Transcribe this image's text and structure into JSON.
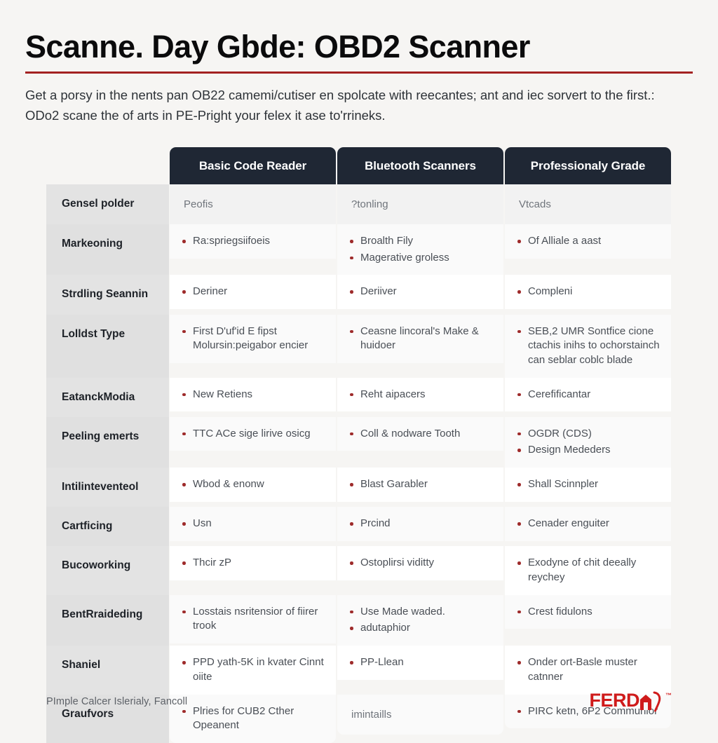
{
  "header": {
    "title": "Scanne. Day Gbde: OBD2 Scanner",
    "intro": "Get a porsy in the nents pan OB22 camemi/cutiser en spolcate with reecantes; ant and iec sorvert to the first.: ODo2 scane the of arts in PE-Pright your felex it ase to'rrineks.",
    "rule_color": "#a32222"
  },
  "table": {
    "corner_label": "",
    "columns": [
      {
        "id": "basic",
        "label": "Basic Code Reader"
      },
      {
        "id": "bluetooth",
        "label": "Bluetooth Scanners"
      },
      {
        "id": "professional",
        "label": "Professionaly Grade"
      }
    ],
    "header_bg": "#1f2734",
    "bullet_color": "#9e2b2b",
    "rows": [
      {
        "label": "Gensel polder",
        "cells": [
          {
            "plain": "Peofis"
          },
          {
            "plain": "?tonling"
          },
          {
            "plain": "Vtcads"
          }
        ]
      },
      {
        "label": "Markeoning",
        "cells": [
          {
            "items": [
              "Ra:spriegsiifoeis"
            ]
          },
          {
            "items": [
              "Broalth Fily",
              "Magerative groless"
            ]
          },
          {
            "items": [
              "Of Alliale a aast"
            ]
          }
        ]
      },
      {
        "label": "Strdling Seannin",
        "cells": [
          {
            "items": [
              "Deriner"
            ]
          },
          {
            "items": [
              "Deriiver"
            ]
          },
          {
            "items": [
              "Compleni"
            ]
          }
        ]
      },
      {
        "label": "Lolldst Type",
        "cells": [
          {
            "items": [
              "First D'uf'id E fipst Molursin:peigabor encier"
            ]
          },
          {
            "items": [
              "Ceasne lincoral's Make & huidoer"
            ]
          },
          {
            "items": [
              "SEB,2 UMR Sontfice cione ctachis inihs to ochorstainch can seblar coblc blade"
            ]
          }
        ]
      },
      {
        "label": "EatanckModia",
        "cells": [
          {
            "items": [
              "New Retiens"
            ]
          },
          {
            "items": [
              "Reht aipacers"
            ]
          },
          {
            "items": [
              "Cerefificantar"
            ]
          }
        ]
      },
      {
        "label": "Peeling emerts",
        "cells": [
          {
            "items": [
              "TTC ACe sige lirive osicg"
            ]
          },
          {
            "items": [
              "Coll & nodware Tooth"
            ]
          },
          {
            "items": [
              "OGDR (CDS)",
              "Design Mededers"
            ]
          }
        ]
      },
      {
        "label": "Intilinteventeol",
        "cells": [
          {
            "items": [
              "Wbod & enonw"
            ]
          },
          {
            "items": [
              "Blast Garabler"
            ]
          },
          {
            "items": [
              "Shall Scinnpler"
            ]
          }
        ]
      },
      {
        "label": "Cartficing",
        "cells": [
          {
            "items": [
              "Usn"
            ]
          },
          {
            "items": [
              "Prcind"
            ]
          },
          {
            "items": [
              "Cenader enguiter"
            ]
          }
        ]
      },
      {
        "label": "Bucoworking",
        "cells": [
          {
            "items": [
              "Thcir zP"
            ]
          },
          {
            "items": [
              "Ostoplirsi viditty"
            ]
          },
          {
            "items": [
              "Exodyne of chit deeally reychey"
            ]
          }
        ]
      },
      {
        "label": "BentRraideding",
        "cells": [
          {
            "items": [
              "Losstais nsritensior of fiirer trook"
            ]
          },
          {
            "items": [
              "Use Made waded.",
              "adutaphior"
            ]
          },
          {
            "items": [
              "Crest fidulons"
            ]
          }
        ]
      },
      {
        "label": "Shaniel",
        "cells": [
          {
            "items": [
              "PPD yath-5K in kvater Cinnt oiite"
            ]
          },
          {
            "items": [
              "PP-Llean"
            ]
          },
          {
            "items": [
              "Onder ort-Basle muster catnner"
            ]
          }
        ]
      },
      {
        "label": "Graufvors",
        "cells": [
          {
            "items": [
              "Plries for CUB2 Cther Opeanent"
            ]
          },
          {
            "plain": "imintaills"
          },
          {
            "items": [
              "PIRC ketn, 6P2 Communior"
            ]
          }
        ]
      }
    ]
  },
  "footer": {
    "note": "PImple Calcer Islerialy, Fancoll",
    "logo_word": "FERD",
    "logo_tm": "™",
    "logo_color": "#cf1b1b"
  }
}
